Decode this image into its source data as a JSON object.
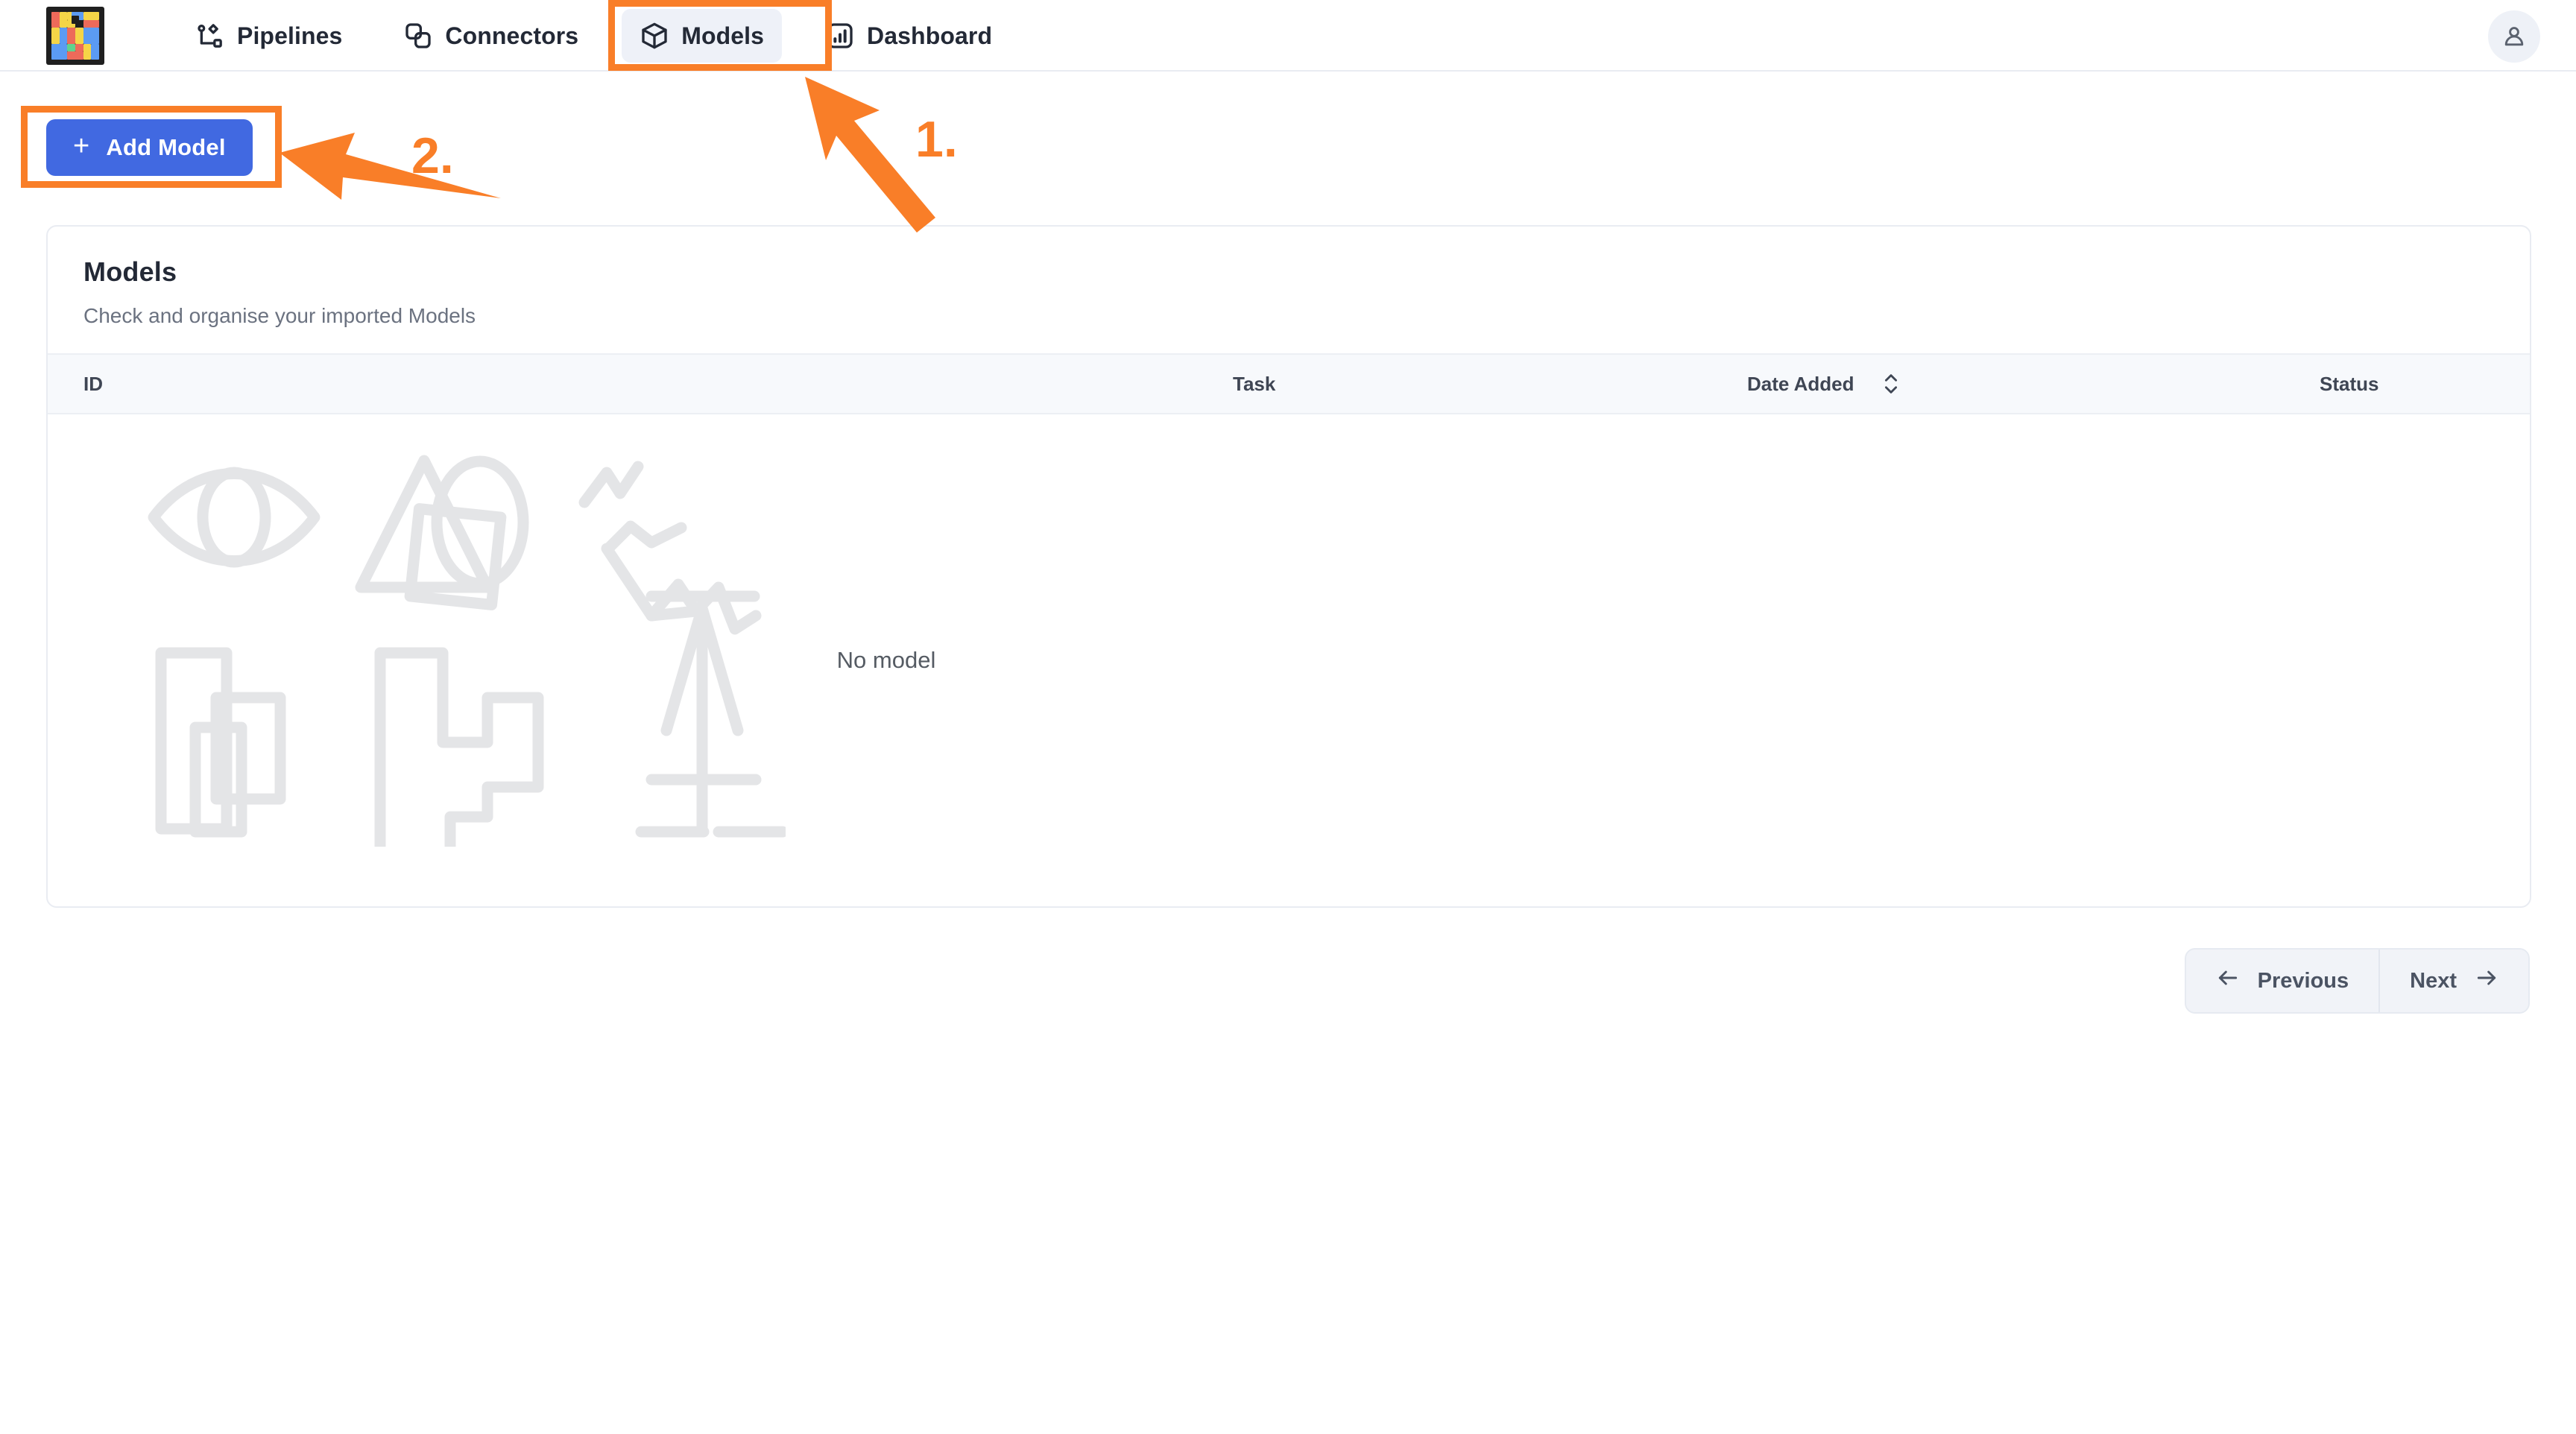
{
  "app": {
    "logo_name": "mosaic-logo",
    "accent_blue": "#4169e1",
    "annotation_orange": "#f97e28"
  },
  "nav": {
    "items": [
      {
        "label": "Pipelines",
        "icon": "pipeline-icon",
        "active": false
      },
      {
        "label": "Connectors",
        "icon": "connectors-icon",
        "active": false
      },
      {
        "label": "Models",
        "icon": "cube-icon",
        "active": true
      },
      {
        "label": "Dashboard",
        "icon": "bar-chart-icon",
        "active": false
      }
    ],
    "avatar_icon": "user-icon"
  },
  "toolbar": {
    "add_model_label": "Add Model",
    "add_model_plus": "+"
  },
  "card": {
    "title": "Models",
    "subtitle": "Check and organise your imported Models",
    "columns": {
      "id": "ID",
      "task": "Task",
      "date_added": "Date Added",
      "status": "Status"
    },
    "sort_icon": "chevron-up-down-icon",
    "empty_message": "No model",
    "rows": []
  },
  "pagination": {
    "previous_label": "Previous",
    "next_label": "Next",
    "prev_icon": "arrow-left-icon",
    "next_icon": "arrow-right-icon"
  },
  "annotations": {
    "step1": "1.",
    "step2": "2."
  }
}
